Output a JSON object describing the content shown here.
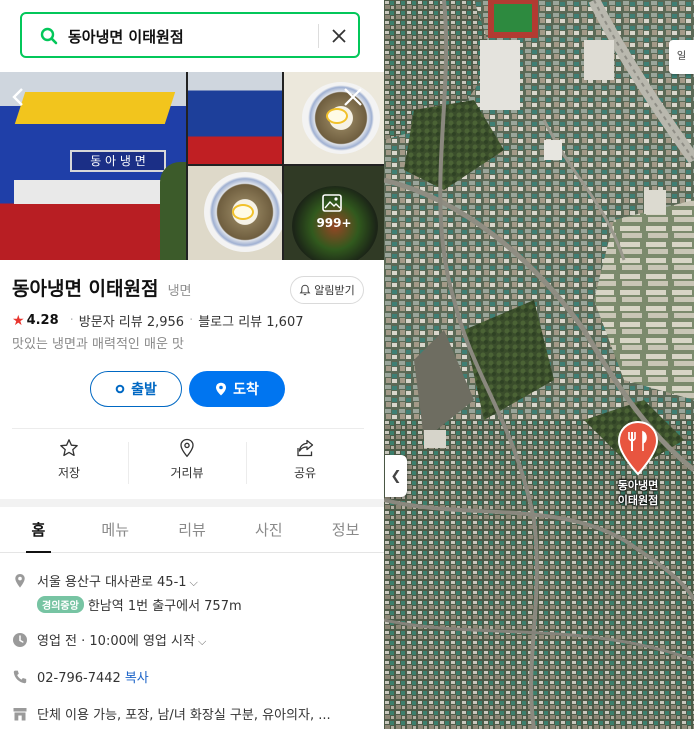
{
  "search": {
    "query": "동아냉면 이태원점"
  },
  "photos": {
    "more_count": "999+"
  },
  "place": {
    "name": "동아냉면 이태원점",
    "category": "냉면",
    "alarm_label": "알림받기",
    "rating": "4.28",
    "visitor_reviews": "방문자 리뷰 2,956",
    "blog_reviews": "블로그 리뷰 1,607",
    "description": "맛있는 냉면과 매력적인 매운 맛"
  },
  "route": {
    "start_label": "출발",
    "end_label": "도착"
  },
  "actions": [
    {
      "label": "저장",
      "icon": "star-outline-icon"
    },
    {
      "label": "거리뷰",
      "icon": "pin-outline-icon"
    },
    {
      "label": "공유",
      "icon": "share-icon"
    }
  ],
  "tabs": [
    "홈",
    "메뉴",
    "리뷰",
    "사진",
    "정보"
  ],
  "details": {
    "address": "서울 용산구 대사관로 45-1",
    "subway_line": "경의중앙",
    "subway_text": "한남역 1번 출구에서 757m",
    "hours": "영업 전 · 10:00에 영업 시작",
    "phone": "02-796-7442",
    "copy_label": "복사",
    "amenities": "단체 이용 가능, 포장, 남/녀 화장실 구분, 유아의자, ..."
  },
  "map": {
    "pin_label_line1": "동아냉면",
    "pin_label_line2": "이태원점",
    "corner_label": "일"
  },
  "colors": {
    "brand_green": "#03c75a",
    "route_blue": "#0075f0",
    "pin_red": "#e8553f",
    "rating_star": "#e8352f",
    "subway_badge": "#77c4a3"
  }
}
